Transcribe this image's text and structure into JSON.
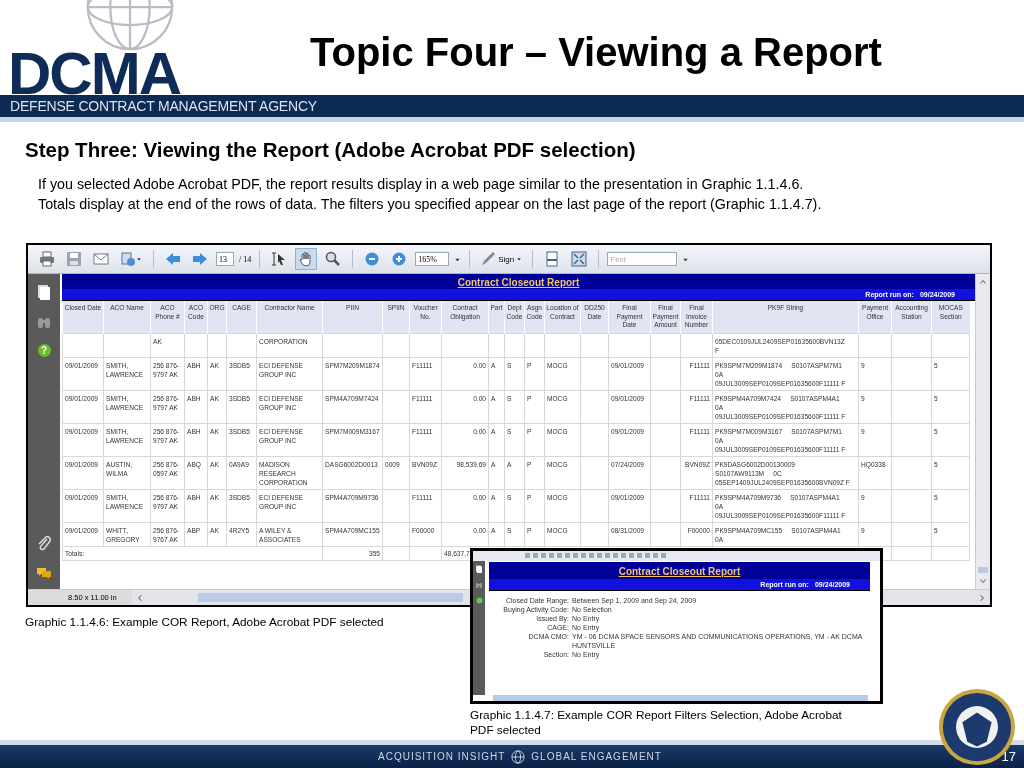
{
  "slide": {
    "logo_text": "DCMA",
    "title": "Topic Four – Viewing a Report",
    "agency": "DEFENSE CONTRACT MANAGEMENT AGENCY",
    "heading": "Step Three: Viewing the Report (Adobe Acrobat PDF selection)",
    "paragraph_lines": [
      "If you selected Adobe Acrobat PDF, the report results display in a web page similar to the presentation in Graphic 1.1.4.6.",
      "Totals display at the end of the rows of data. The filters you specified appear on the last page of the report (Graphic 1.1.4.7)."
    ],
    "footer": [
      "ACQUISITION INSIGHT",
      "GLOBAL ENGAGEMENT"
    ],
    "page_number": "17"
  },
  "report_viewer": {
    "toolbar": [
      {
        "kind": "print",
        "selected": false
      },
      {
        "kind": "save",
        "selected": false
      },
      {
        "kind": "email",
        "selected": false
      },
      {
        "kind": "share",
        "selected": false
      },
      {
        "kind": "previous",
        "selected": false
      },
      {
        "kind": "next",
        "selected": false
      },
      {
        "kind": "page",
        "value": "13",
        "total": "/ 14"
      },
      {
        "kind": "select",
        "selected": false
      },
      {
        "kind": "hand",
        "selected": true
      },
      {
        "kind": "zoom-tool",
        "selected": false
      },
      {
        "kind": "zoom-out",
        "selected": false
      },
      {
        "kind": "zoom-in",
        "selected": false
      },
      {
        "kind": "zoom",
        "value": "165%"
      },
      {
        "kind": "sign",
        "label": "Sign"
      },
      {
        "kind": "fit-page",
        "selected": false
      },
      {
        "kind": "full-screen",
        "selected": false
      },
      {
        "kind": "find",
        "placeholder": "Find"
      }
    ],
    "sidebar": [
      {
        "kind": "pages"
      },
      {
        "kind": "search"
      },
      {
        "kind": "help",
        "glyph": "?"
      },
      {
        "kind": "attachment"
      },
      {
        "kind": "comments"
      }
    ],
    "report": {
      "title": "Contract Closeout Report",
      "run_label": "Report run on:",
      "run_date": "09/24/2009"
    },
    "table": {
      "columns": [
        "Closed Date",
        "ACO Name",
        "ACO Phone #",
        "ACO Code",
        "ORG",
        "CAGE",
        "Contractor Name",
        "PIIN",
        "SPIIN",
        "Voucher No.",
        "Contract Obligation",
        "Part",
        "Dept Code",
        "Asgn Code",
        "Location of Contract",
        "DD250 Date",
        "Final Payment Date",
        "Final Payment Amount",
        "Final Invoice Number",
        "PK9F String",
        "Payment Office",
        "Accounting Station",
        "MOCAS Section"
      ],
      "rows": [
        [
          null,
          null,
          "AK",
          null,
          null,
          null,
          "CORPORATION",
          null,
          null,
          null,
          null,
          null,
          null,
          null,
          null,
          null,
          null,
          null,
          null,
          "05DEC0109JUL2409SEP01635600BVN13Z\nF",
          null,
          null,
          null
        ],
        [
          "09/01/2009",
          "SMITH, LAWRENCE",
          "256 876-9797 AK",
          "ABH",
          "AK",
          "3SDB5",
          "ECI DEFENSE GROUP INC",
          "SPM7M209M1874",
          null,
          "F11111",
          "0.00",
          "A",
          "S",
          "P",
          "MOCG",
          null,
          "09/01/2009",
          null,
          "F11111",
          "PK9SPM7M209M1874     S0107ASPM7M1\n0A\n09JUL3009SEP0109SEP01635600F11111 F",
          "9",
          null,
          "5"
        ],
        [
          "09/01/2009",
          "SMITH, LAWRENCE",
          "256 876-9797 AK",
          "ABH",
          "AK",
          "3SDB5",
          "ECI DEFENSE GROUP INC",
          "SPM4A709M7424",
          null,
          "F11111",
          "0.00",
          "A",
          "S",
          "P",
          "MOCG",
          null,
          "09/01/2009",
          null,
          "F11111",
          "PK9SPM4A709M7424     S0107ASPM4A1\n0A\n09JUL3009SEP0109SEP01635600F11111 F",
          "9",
          null,
          "5"
        ],
        [
          "09/01/2009",
          "SMITH, LAWRENCE",
          "256 876-9797 AK",
          "ABH",
          "AK",
          "3SDB5",
          "ECI DEFENSE GROUP INC",
          "SPM7M009M3167",
          null,
          "F11111",
          "0.00",
          "A",
          "S",
          "P",
          "MOCG",
          null,
          "09/01/2009",
          null,
          "F11111",
          "PK9SPM7M009M3167     S0107ASPM7M1\n0A\n09JUL3009SEP0109SEP01635600F11111 F",
          "9",
          null,
          "5"
        ],
        [
          "09/01/2009",
          "AUSTIN, WILMA",
          "256 876-0597 AK",
          "ABQ",
          "AK",
          "0A9A9",
          "MADISON RESEARCH CORPORATION",
          "DASG6002D0013",
          "0009",
          "BVN09Z",
          "98,539.69",
          "A",
          "A",
          "P",
          "MOCG",
          null,
          "07/24/2009",
          null,
          "BVN09Z",
          "PK9DASG6002D00130009\nS0107AW9113M     0C\n05SEP1409JUL2409SEP01635600BVN09Z F",
          "HQ0338",
          null,
          "5"
        ],
        [
          "09/01/2009",
          "SMITH, LAWRENCE",
          "256 876-9797 AK",
          "ABH",
          "AK",
          "3SDB5",
          "ECI DEFENSE GROUP INC",
          "SPM4A709M9736",
          null,
          "F11111",
          "0.00",
          "A",
          "S",
          "P",
          "MOCG",
          null,
          "09/01/2009",
          null,
          "F11111",
          "PK9SPM4A709M9736     S0107ASPM4A1\n0A\n09JUL3009SEP0109SEP01635600F11111 F",
          "9",
          null,
          "5"
        ],
        [
          "09/01/2009",
          "WHITT, GREGORY",
          "256 876-9767 AK",
          "ABP",
          "AK",
          "4R2Y5",
          "A WILEY & ASSOCIATES",
          "SPM4A709MC155",
          null,
          "F00000",
          "0.00",
          "A",
          "S",
          "P",
          "MOCG",
          null,
          "08/31/2009",
          null,
          "F00000",
          "PK9SPM4A709MC155     S0107ASPM4A1\n0A",
          "9",
          null,
          "5"
        ]
      ],
      "totals": {
        "label": "Totals:",
        "cells": [
          "355",
          null,
          null,
          "48,637,7"
        ]
      }
    },
    "page_size": "8.50 x 11.00 in"
  },
  "caption_1": "Graphic 1.1.4.6: Example COR Report, Adobe Acrobat PDF selected",
  "filters_viewer": {
    "report": {
      "title": "Contract Closeout Report",
      "run_label": "Report run on:",
      "run_date": "09/24/2009"
    },
    "filters": [
      {
        "label": "Closed Date Range:",
        "value": "Between Sep 1, 2009 and Sep 24, 2009"
      },
      {
        "label": "Buying Activity Code:",
        "value": "No Selection"
      },
      {
        "label": "Issued By:",
        "value": "No Entry"
      },
      {
        "label": "CAGE:",
        "value": "No Entry"
      },
      {
        "label": "DCMA CMO:",
        "value": "YM - 06 DCMA SPACE SENSORS AND COMMUNICATIONS OPERATIONS, YM - AK DCMA HUNTSVILLE"
      },
      {
        "label": "Section:",
        "value": "No Entry"
      }
    ]
  },
  "caption_2": "Graphic 1.1.4.7: Example COR Report Filters Selection, Adobe Acrobat PDF selected"
}
